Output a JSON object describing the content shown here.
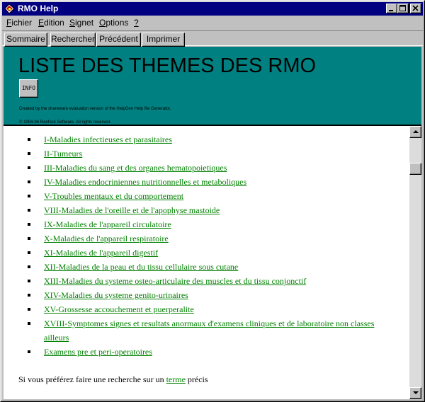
{
  "window": {
    "title": "RMO Help",
    "icons": {
      "app": "help-book-icon",
      "minimize": "minimize-icon",
      "maximize": "maximize-icon",
      "close": "close-icon"
    }
  },
  "menu": [
    {
      "accel": "F",
      "rest": "ichier"
    },
    {
      "accel": "E",
      "rest": "dition"
    },
    {
      "accel": "S",
      "rest": "ignet"
    },
    {
      "accel": "O",
      "rest": "ptions"
    },
    {
      "accel": "?",
      "rest": ""
    }
  ],
  "buttons": {
    "sommaire": "Sommaire",
    "rechercher": "Rechercher",
    "precedent": "Précédent",
    "imprimer": "Imprimer"
  },
  "banner": {
    "title": "LISTE DES THEMES DES RMO",
    "info_label": "INFO",
    "generator_note": "Created by the shareware evaluation version of the HelpGen Help file Generator.",
    "copyright": "© 1994-96 Ranfock Software.  All rights reserved.",
    "background_color": "#008080"
  },
  "topics": [
    "I-Maladies infectieuses et parasitaires",
    "II-Tumeurs",
    "III-Maladies du sang et des organes hematopoietiques",
    "IV-Maladies endocriniennes nutritionnelles et metaboliques",
    "V-Troubles mentaux et du comportement",
    "VIII-Maladies de l'oreille et de l'apophyse mastoide",
    "IX-Maladies de l'appareil circulatoire",
    "X-Maladies de l'appareil respiratoire",
    "XI-Maladies de l'appareil digestif",
    "XII-Maladies de la peau et du tissu cellulaire sous cutane",
    "XIII-Maladies du systeme osteo-articulaire des muscles et du tissu conjonctif",
    "XIV-Maladies du systeme genito-urinaires",
    "XV-Grossesse accouchement et puerperalite",
    "XVIII-Symptomes signes et resultats anormaux d'examens cliniques et de laboratoire non classes ailleurs",
    "Examens pre et peri-operatoires"
  ],
  "search": {
    "before": "Si vous préférez faire une recherche sur un ",
    "link": "terme",
    "after": " précis"
  },
  "colors": {
    "link": "#008000",
    "titlebar": "#000080"
  }
}
